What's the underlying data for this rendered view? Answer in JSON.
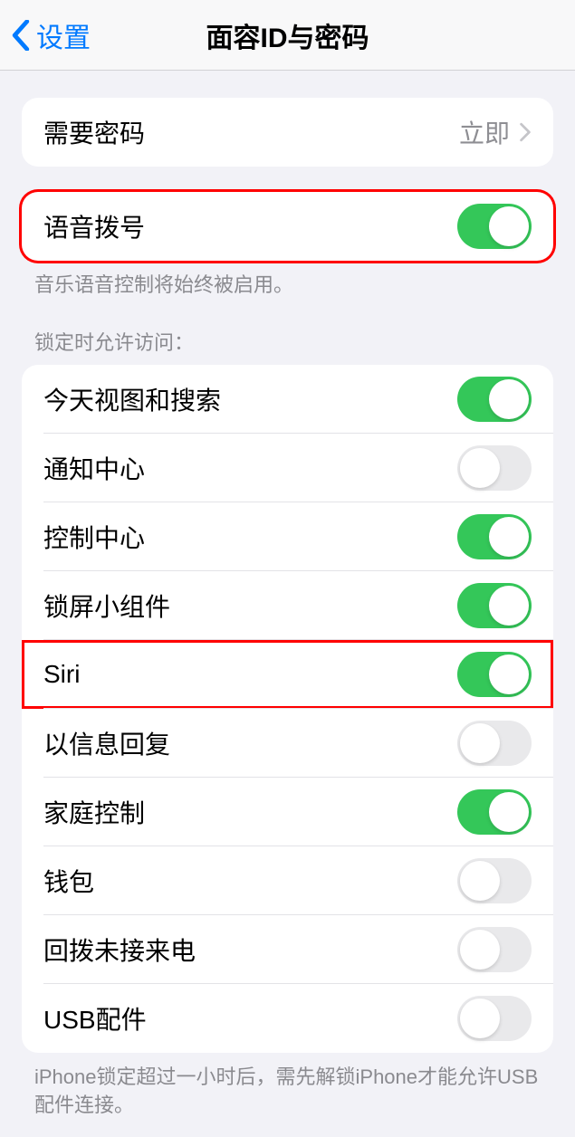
{
  "header": {
    "back_label": "设置",
    "title": "面容ID与密码"
  },
  "require_passcode": {
    "label": "需要密码",
    "value": "立即"
  },
  "voice_dial": {
    "label": "语音拨号",
    "enabled": true,
    "footer": "音乐语音控制将始终被启用。"
  },
  "lock_access": {
    "section_title": "锁定时允许访问：",
    "items": [
      {
        "label": "今天视图和搜索",
        "enabled": true
      },
      {
        "label": "通知中心",
        "enabled": false
      },
      {
        "label": "控制中心",
        "enabled": true
      },
      {
        "label": "锁屏小组件",
        "enabled": true
      },
      {
        "label": "Siri",
        "enabled": true,
        "highlighted": true
      },
      {
        "label": "以信息回复",
        "enabled": false
      },
      {
        "label": "家庭控制",
        "enabled": true
      },
      {
        "label": "钱包",
        "enabled": false
      },
      {
        "label": "回拨未接来电",
        "enabled": false
      },
      {
        "label": "USB配件",
        "enabled": false
      }
    ],
    "footer": "iPhone锁定超过一小时后，需先解锁iPhone才能允许USB配件连接。"
  }
}
